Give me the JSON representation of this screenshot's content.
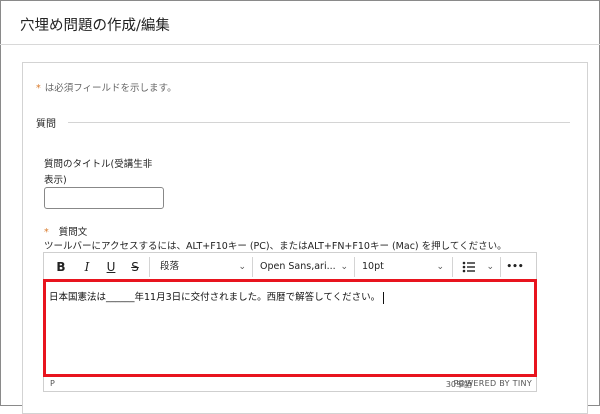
{
  "page": {
    "title": "穴埋め問題の作成/編集"
  },
  "form": {
    "required_note": "は必須フィールドを示します。",
    "section_heading": "質問",
    "question_title_label": "質問のタイトル(受講生非表示)",
    "question_title_value": "",
    "question_text_label": "質問文",
    "toolbar_hint": "ツールバーにアクセスするには、ALT+F10キー (PC)、またはALT+FN+F10キー (Mac) を押してください。"
  },
  "editor": {
    "toolbar": {
      "bold": "B",
      "italic": "I",
      "underline": "U",
      "strikethrough": "S",
      "paragraph": "段落",
      "font": "Open Sans,ari...",
      "size": "10pt",
      "more": "•••"
    },
    "content": "日本国憲法は______年11月3日に交付されました。西暦で解答してください。",
    "status": {
      "path": "P",
      "word_count": "30単語",
      "powered_by": "POWERED BY TINY"
    }
  },
  "icons": {
    "required": "asterisk-icon",
    "list": "bullet-list-icon",
    "dropdown": "chevron-down-icon"
  },
  "colors": {
    "required_star": "#d97a2b",
    "highlight": "#e8141e"
  }
}
